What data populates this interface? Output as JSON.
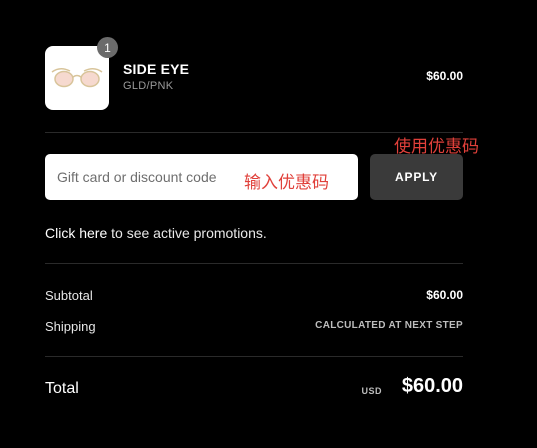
{
  "product": {
    "quantity": "1",
    "name": "SIDE EYE",
    "variant": "GLD/PNK",
    "price": "$60.00",
    "image_icon": "sunglasses-icon"
  },
  "discount": {
    "placeholder": "Gift card or discount code",
    "apply_label": "APPLY",
    "annotation_input": "输入优惠码",
    "annotation_apply": "使用优惠码"
  },
  "promotions": {
    "link_text": "Click here",
    "rest_text": " to see active promotions."
  },
  "summary": {
    "subtotal_label": "Subtotal",
    "subtotal_value": "$60.00",
    "shipping_label": "Shipping",
    "shipping_value": "CALCULATED AT NEXT STEP",
    "total_label": "Total",
    "currency": "USD",
    "total_value": "$60.00"
  },
  "colors": {
    "background": "#000000",
    "annotation": "#e0403a",
    "apply_button": "#3a3a3a"
  }
}
